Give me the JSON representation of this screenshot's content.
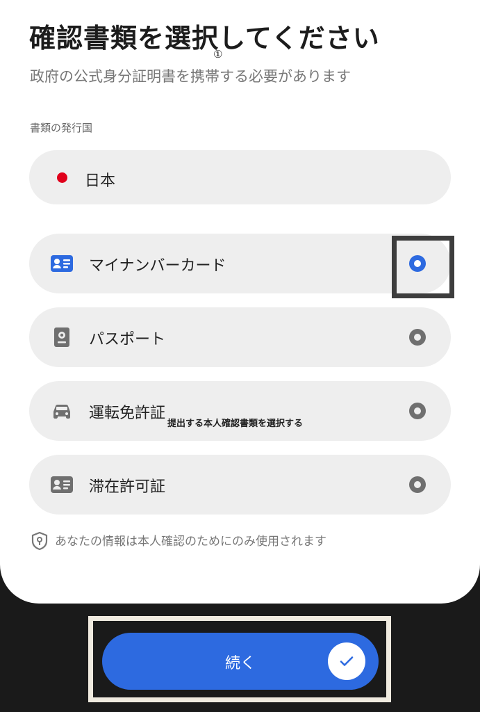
{
  "header": {
    "title": "確認書類を選択してください",
    "marker": "①",
    "subtitle": "政府の公式身分証明書を携帯する必要があります"
  },
  "country_section": {
    "label": "書類の発行国",
    "selected_country": "日本",
    "flag_color": "#e0001b"
  },
  "documents": [
    {
      "label": "マイナンバーカード",
      "icon": "id-card-icon",
      "selected": true
    },
    {
      "label": "パスポート",
      "icon": "passport-icon",
      "selected": false
    },
    {
      "label": "運転免許証",
      "icon": "car-icon",
      "selected": false
    },
    {
      "label": "滞在許可証",
      "icon": "residence-card-icon",
      "selected": false
    }
  ],
  "tooltip": "提出する本人確認書類を選択する",
  "privacy_note": "あなたの情報は本人確認のためにのみ使用されます",
  "continue_button": {
    "label": "続く"
  },
  "colors": {
    "accent": "#2d6ae0",
    "background_dark": "#1a1a1a",
    "card": "#eeeeee"
  }
}
